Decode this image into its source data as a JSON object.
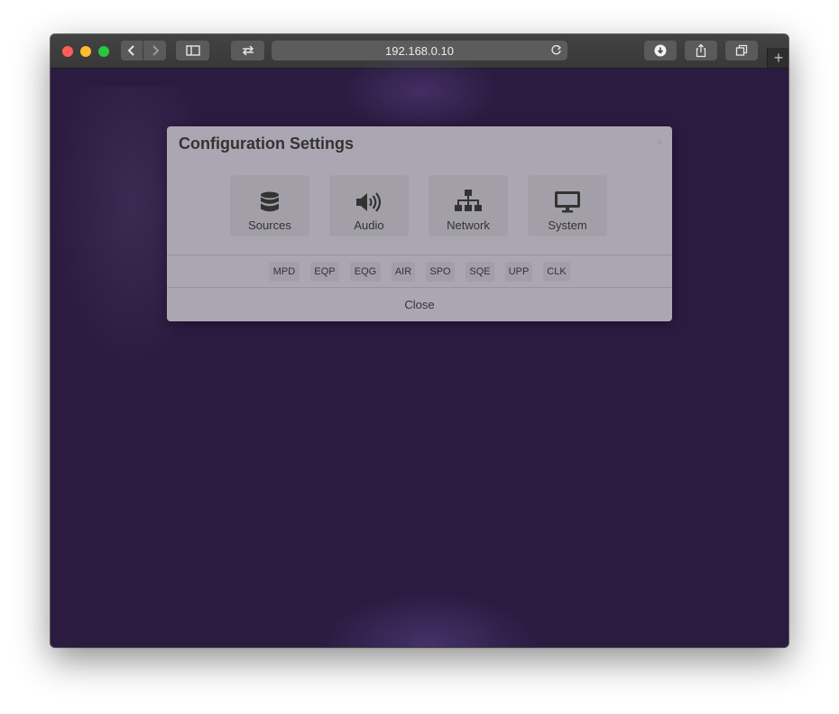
{
  "browser": {
    "address": "192.168.0.10",
    "new_tab_symbol": "+"
  },
  "modal": {
    "title": "Configuration Settings",
    "close_x": "×",
    "tiles": [
      {
        "label": "Sources",
        "icon": "database-icon"
      },
      {
        "label": "Audio",
        "icon": "speaker-icon"
      },
      {
        "label": "Network",
        "icon": "network-icon"
      },
      {
        "label": "System",
        "icon": "monitor-icon"
      }
    ],
    "chips": [
      "MPD",
      "EQP",
      "EQG",
      "AIR",
      "SPO",
      "SQE",
      "UPP",
      "CLK"
    ],
    "close_label": "Close"
  },
  "colors": {
    "background": "#2b1b41",
    "modal": "#aba7b2",
    "tile": "#a29fa9",
    "text": "#333333"
  }
}
